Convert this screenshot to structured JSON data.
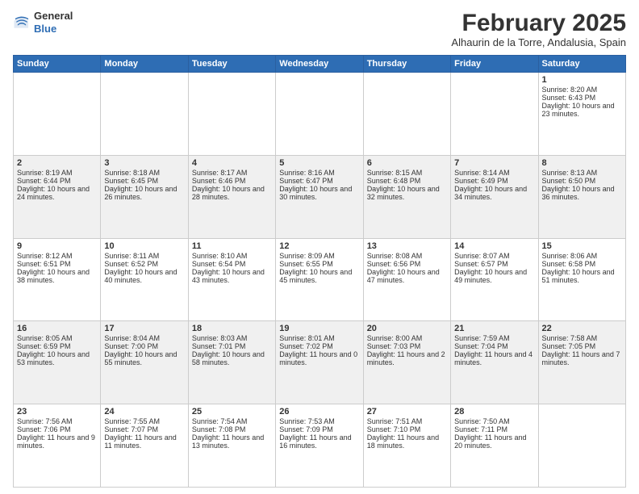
{
  "header": {
    "logo_general": "General",
    "logo_blue": "Blue",
    "month_year": "February 2025",
    "location": "Alhaurin de la Torre, Andalusia, Spain"
  },
  "days_of_week": [
    "Sunday",
    "Monday",
    "Tuesday",
    "Wednesday",
    "Thursday",
    "Friday",
    "Saturday"
  ],
  "weeks": [
    [
      {
        "day": "",
        "info": ""
      },
      {
        "day": "",
        "info": ""
      },
      {
        "day": "",
        "info": ""
      },
      {
        "day": "",
        "info": ""
      },
      {
        "day": "",
        "info": ""
      },
      {
        "day": "",
        "info": ""
      },
      {
        "day": "1",
        "info": "Sunrise: 8:20 AM\nSunset: 6:43 PM\nDaylight: 10 hours and 23 minutes."
      }
    ],
    [
      {
        "day": "2",
        "info": "Sunrise: 8:19 AM\nSunset: 6:44 PM\nDaylight: 10 hours and 24 minutes."
      },
      {
        "day": "3",
        "info": "Sunrise: 8:18 AM\nSunset: 6:45 PM\nDaylight: 10 hours and 26 minutes."
      },
      {
        "day": "4",
        "info": "Sunrise: 8:17 AM\nSunset: 6:46 PM\nDaylight: 10 hours and 28 minutes."
      },
      {
        "day": "5",
        "info": "Sunrise: 8:16 AM\nSunset: 6:47 PM\nDaylight: 10 hours and 30 minutes."
      },
      {
        "day": "6",
        "info": "Sunrise: 8:15 AM\nSunset: 6:48 PM\nDaylight: 10 hours and 32 minutes."
      },
      {
        "day": "7",
        "info": "Sunrise: 8:14 AM\nSunset: 6:49 PM\nDaylight: 10 hours and 34 minutes."
      },
      {
        "day": "8",
        "info": "Sunrise: 8:13 AM\nSunset: 6:50 PM\nDaylight: 10 hours and 36 minutes."
      }
    ],
    [
      {
        "day": "9",
        "info": "Sunrise: 8:12 AM\nSunset: 6:51 PM\nDaylight: 10 hours and 38 minutes."
      },
      {
        "day": "10",
        "info": "Sunrise: 8:11 AM\nSunset: 6:52 PM\nDaylight: 10 hours and 40 minutes."
      },
      {
        "day": "11",
        "info": "Sunrise: 8:10 AM\nSunset: 6:54 PM\nDaylight: 10 hours and 43 minutes."
      },
      {
        "day": "12",
        "info": "Sunrise: 8:09 AM\nSunset: 6:55 PM\nDaylight: 10 hours and 45 minutes."
      },
      {
        "day": "13",
        "info": "Sunrise: 8:08 AM\nSunset: 6:56 PM\nDaylight: 10 hours and 47 minutes."
      },
      {
        "day": "14",
        "info": "Sunrise: 8:07 AM\nSunset: 6:57 PM\nDaylight: 10 hours and 49 minutes."
      },
      {
        "day": "15",
        "info": "Sunrise: 8:06 AM\nSunset: 6:58 PM\nDaylight: 10 hours and 51 minutes."
      }
    ],
    [
      {
        "day": "16",
        "info": "Sunrise: 8:05 AM\nSunset: 6:59 PM\nDaylight: 10 hours and 53 minutes."
      },
      {
        "day": "17",
        "info": "Sunrise: 8:04 AM\nSunset: 7:00 PM\nDaylight: 10 hours and 55 minutes."
      },
      {
        "day": "18",
        "info": "Sunrise: 8:03 AM\nSunset: 7:01 PM\nDaylight: 10 hours and 58 minutes."
      },
      {
        "day": "19",
        "info": "Sunrise: 8:01 AM\nSunset: 7:02 PM\nDaylight: 11 hours and 0 minutes."
      },
      {
        "day": "20",
        "info": "Sunrise: 8:00 AM\nSunset: 7:03 PM\nDaylight: 11 hours and 2 minutes."
      },
      {
        "day": "21",
        "info": "Sunrise: 7:59 AM\nSunset: 7:04 PM\nDaylight: 11 hours and 4 minutes."
      },
      {
        "day": "22",
        "info": "Sunrise: 7:58 AM\nSunset: 7:05 PM\nDaylight: 11 hours and 7 minutes."
      }
    ],
    [
      {
        "day": "23",
        "info": "Sunrise: 7:56 AM\nSunset: 7:06 PM\nDaylight: 11 hours and 9 minutes."
      },
      {
        "day": "24",
        "info": "Sunrise: 7:55 AM\nSunset: 7:07 PM\nDaylight: 11 hours and 11 minutes."
      },
      {
        "day": "25",
        "info": "Sunrise: 7:54 AM\nSunset: 7:08 PM\nDaylight: 11 hours and 13 minutes."
      },
      {
        "day": "26",
        "info": "Sunrise: 7:53 AM\nSunset: 7:09 PM\nDaylight: 11 hours and 16 minutes."
      },
      {
        "day": "27",
        "info": "Sunrise: 7:51 AM\nSunset: 7:10 PM\nDaylight: 11 hours and 18 minutes."
      },
      {
        "day": "28",
        "info": "Sunrise: 7:50 AM\nSunset: 7:11 PM\nDaylight: 11 hours and 20 minutes."
      },
      {
        "day": "",
        "info": ""
      }
    ]
  ]
}
